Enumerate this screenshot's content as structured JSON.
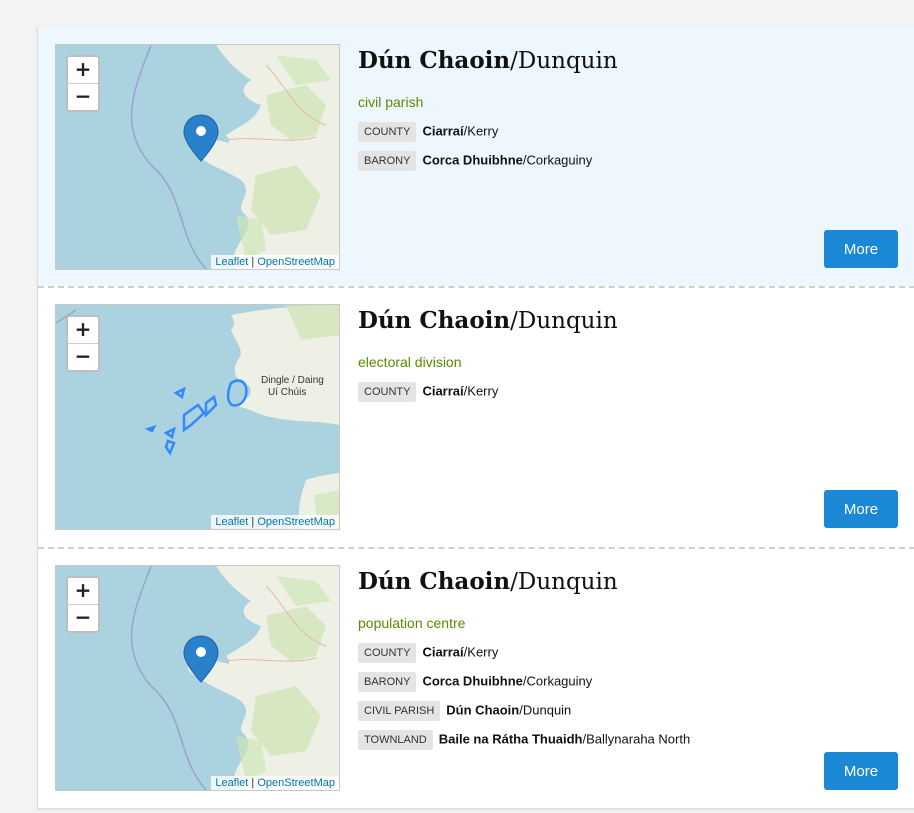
{
  "map_attribution": {
    "leaflet": "Leaflet",
    "separator": " | ",
    "osm": "OpenStreetMap"
  },
  "zoom": {
    "in": "+",
    "out": "−"
  },
  "map_labels": {
    "dingle_line1": "Dingle / Daing",
    "dingle_line2": "Uí Chúis"
  },
  "colors": {
    "sea": "#aad3df",
    "land": "#eef0e6",
    "marker": "#2a81cb",
    "boundary": "#3388ff",
    "accent_button": "#1b88d6",
    "place_type": "#5a8a00",
    "highlight_row": "#eef7fd"
  },
  "results": [
    {
      "name_ga": "Dún Chaoin",
      "sep": "/",
      "name_en": "Dunquin",
      "type": "civil parish",
      "more": "More",
      "map_icon": "map-marker-icon",
      "rows": [
        {
          "tag": "COUNTY",
          "ga": "Ciarraí",
          "sep": "/",
          "en": "Kerry"
        },
        {
          "tag": "BARONY",
          "ga": "Corca Dhuibhne",
          "sep": "/",
          "en": "Corkaguiny"
        }
      ]
    },
    {
      "name_ga": "Dún Chaoin",
      "sep": "/",
      "name_en": "Dunquin",
      "type": "electoral division",
      "more": "More",
      "map_icon": "boundary-outline",
      "rows": [
        {
          "tag": "COUNTY",
          "ga": "Ciarraí",
          "sep": "/",
          "en": "Kerry"
        }
      ]
    },
    {
      "name_ga": "Dún Chaoin",
      "sep": "/",
      "name_en": "Dunquin",
      "type": "population centre",
      "more": "More",
      "map_icon": "map-marker-icon",
      "rows": [
        {
          "tag": "COUNTY",
          "ga": "Ciarraí",
          "sep": "/",
          "en": "Kerry"
        },
        {
          "tag": "BARONY",
          "ga": "Corca Dhuibhne",
          "sep": "/",
          "en": "Corkaguiny"
        },
        {
          "tag": "CIVIL PARISH",
          "ga": "Dún Chaoin",
          "sep": "/",
          "en": "Dunquin"
        },
        {
          "tag": "TOWNLAND",
          "ga": "Baile na Rátha Thuaidh",
          "sep": "/",
          "en": "Ballynaraha North"
        }
      ]
    }
  ]
}
